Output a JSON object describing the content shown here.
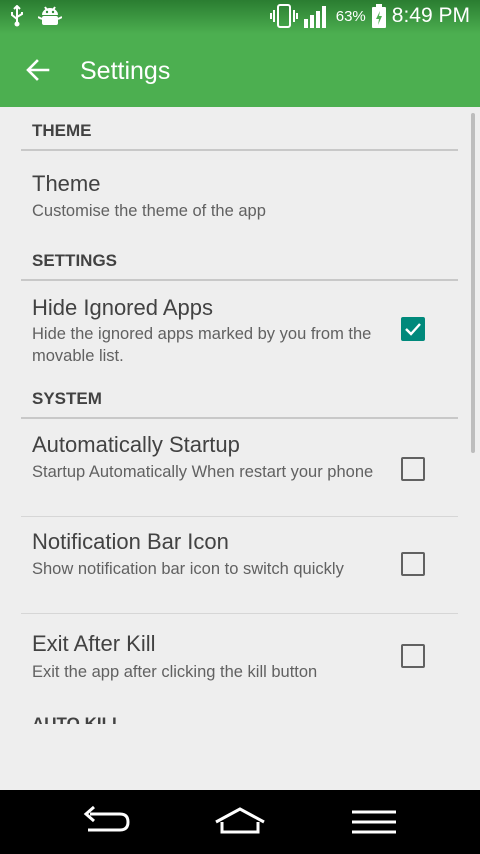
{
  "status_bar": {
    "battery_percent": "63%",
    "time": "8:49 PM",
    "icons": [
      "usb-icon",
      "android-debug-icon",
      "vibrate-icon",
      "signal-icon",
      "battery-charging-icon"
    ]
  },
  "app_bar": {
    "title": "Settings",
    "back_icon": "arrow-back-icon",
    "color": "#4caf50"
  },
  "sections": [
    {
      "header": "THEME",
      "items": [
        {
          "title": "Theme",
          "summary": "Customise the theme of the app"
        }
      ]
    },
    {
      "header": "SETTINGS",
      "items": [
        {
          "title": "Hide Ignored Apps",
          "summary": "Hide the ignored apps marked by you from the movable list.",
          "checked": true
        }
      ]
    },
    {
      "header": "SYSTEM",
      "items": [
        {
          "title": "Automatically Startup",
          "summary": "Startup Automatically When restart your phone",
          "checked": false
        },
        {
          "title": "Notification Bar Icon",
          "summary": "Show notification bar icon to switch quickly",
          "checked": false
        },
        {
          "title": "Exit After Kill",
          "summary": "Exit the app after clicking the kill button",
          "checked": false
        }
      ]
    },
    {
      "header": "AUTO KILL",
      "items": []
    }
  ],
  "nav_bar": {
    "buttons": [
      "back-nav-icon",
      "home-nav-icon",
      "menu-nav-icon"
    ]
  },
  "accent_color": "#00897b"
}
